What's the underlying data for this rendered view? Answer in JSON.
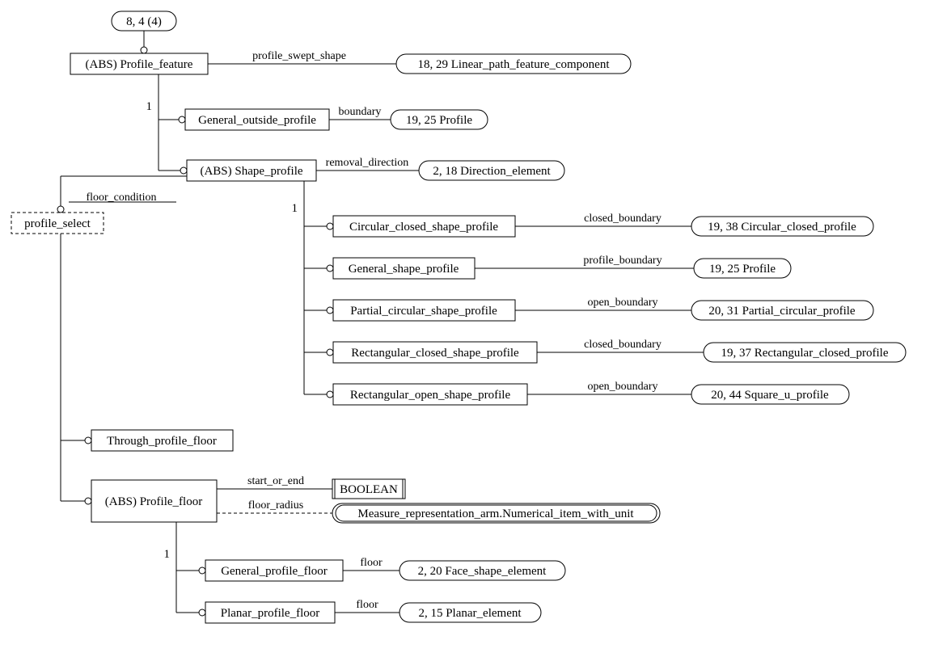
{
  "root_ref": "8, 4 (4)",
  "profile_feature": "(ABS) Profile_feature",
  "profile_swept_shape_lbl": "profile_swept_shape",
  "linear_path": "18, 29 Linear_path_feature_component",
  "one_a": "1",
  "general_outside_profile": "General_outside_profile",
  "boundary_lbl": "boundary",
  "profile_ref_1": "19, 25 Profile",
  "shape_profile": "(ABS) Shape_profile",
  "removal_direction_lbl": "removal_direction",
  "direction_elem": "2, 18 Direction_element",
  "floor_condition_lbl": "floor_condition",
  "profile_select": "profile_select",
  "one_b": "1",
  "circ_closed_sp": "Circular_closed_shape_profile",
  "closed_boundary_lbl_1": "closed_boundary",
  "circ_closed_prof": "19, 38 Circular_closed_profile",
  "general_sp": "General_shape_profile",
  "profile_boundary_lbl": "profile_boundary",
  "profile_ref_2": "19, 25 Profile",
  "partial_circ_sp": "Partial_circular_shape_profile",
  "open_boundary_lbl_1": "open_boundary",
  "partial_circ_prof": "20, 31 Partial_circular_profile",
  "rect_closed_sp": "Rectangular_closed_shape_profile",
  "closed_boundary_lbl_2": "closed_boundary",
  "rect_closed_prof": "19, 37 Rectangular_closed_profile",
  "rect_open_sp": "Rectangular_open_shape_profile",
  "open_boundary_lbl_2": "open_boundary",
  "square_u_prof": "20, 44 Square_u_profile",
  "through_pf": "Through_profile_floor",
  "abs_pf": "(ABS) Profile_floor",
  "start_or_end_lbl": "start_or_end",
  "boolean": "BOOLEAN",
  "floor_radius_lbl": "floor_radius",
  "measure_rep": "Measure_representation_arm.Numerical_item_with_unit",
  "one_c": "1",
  "general_pf": "General_profile_floor",
  "floor_lbl_1": "floor",
  "face_shape": "2, 20 Face_shape_element",
  "planar_pf": "Planar_profile_floor",
  "floor_lbl_2": "floor",
  "planar_elem": "2, 15 Planar_element"
}
